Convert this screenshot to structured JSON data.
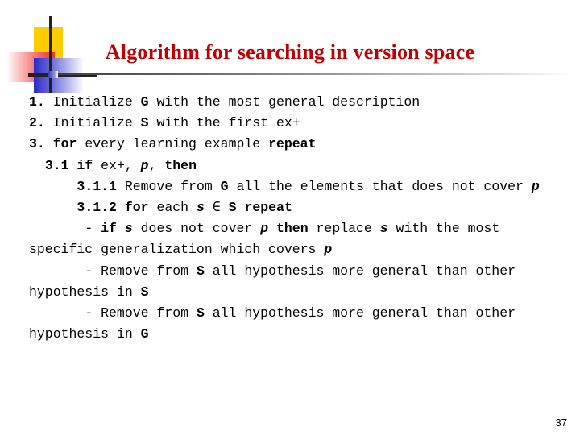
{
  "slide": {
    "title": "Algorithm for searching in version space",
    "title_color": "#C00000",
    "page_number": "37"
  },
  "decoration": {
    "yellow_swatch_color": "#FFCC00",
    "red_swatch_color": "#F03030",
    "blue_swatch_color": "#2B2BC8",
    "crossbar_color": "#222222"
  },
  "algorithm": {
    "lines": [
      {
        "id": "step-1",
        "segments": [
          {
            "text": "1. ",
            "style": "bold"
          },
          {
            "text": "Initialize ",
            "style": "normal"
          },
          {
            "text": "G",
            "style": "bold"
          },
          {
            "text": " with the most general description",
            "style": "normal"
          }
        ]
      },
      {
        "id": "step-2",
        "segments": [
          {
            "text": "2. ",
            "style": "bold"
          },
          {
            "text": "Initialize ",
            "style": "normal"
          },
          {
            "text": "S",
            "style": "bold"
          },
          {
            "text": " with the first ex+",
            "style": "normal"
          }
        ]
      },
      {
        "id": "step-3",
        "segments": [
          {
            "text": "3. ",
            "style": "bold"
          },
          {
            "text": "for",
            "style": "bold"
          },
          {
            "text": " every learning example ",
            "style": "normal"
          },
          {
            "text": "repeat",
            "style": "bold"
          }
        ]
      },
      {
        "id": "step-3-1",
        "segments": [
          {
            "text": "  3.1 ",
            "style": "bold"
          },
          {
            "text": "if",
            "style": "bold"
          },
          {
            "text": " ex+, ",
            "style": "normal"
          },
          {
            "text": "p",
            "style": "bold-italic"
          },
          {
            "text": ", ",
            "style": "normal"
          },
          {
            "text": "then",
            "style": "bold"
          }
        ]
      },
      {
        "id": "step-3-1-1",
        "segments": [
          {
            "text": "      3.1.1 ",
            "style": "bold"
          },
          {
            "text": "Remove from ",
            "style": "normal"
          },
          {
            "text": "G",
            "style": "bold"
          },
          {
            "text": " all the elements that does not cover ",
            "style": "normal"
          },
          {
            "text": "p",
            "style": "bold-italic"
          }
        ]
      },
      {
        "id": "step-3-1-2",
        "segments": [
          {
            "text": "      3.1.2 ",
            "style": "bold"
          },
          {
            "text": "for",
            "style": "bold"
          },
          {
            "text": " each ",
            "style": "normal"
          },
          {
            "text": "s",
            "style": "bold-italic"
          },
          {
            "text": " ∈ ",
            "style": "normal"
          },
          {
            "text": "S",
            "style": "bold"
          },
          {
            "text": " ",
            "style": "normal"
          },
          {
            "text": "repeat",
            "style": "bold"
          }
        ]
      },
      {
        "id": "substep-if-s",
        "segments": [
          {
            "text": "       - ",
            "style": "normal"
          },
          {
            "text": "if",
            "style": "bold"
          },
          {
            "text": " ",
            "style": "normal"
          },
          {
            "text": "s",
            "style": "bold-italic"
          },
          {
            "text": " does not cover ",
            "style": "normal"
          },
          {
            "text": "p",
            "style": "bold-italic"
          },
          {
            "text": " ",
            "style": "normal"
          },
          {
            "text": "then",
            "style": "bold"
          },
          {
            "text": " replace ",
            "style": "normal"
          },
          {
            "text": "s",
            "style": "bold-italic"
          },
          {
            "text": " with the most specific generalization which covers ",
            "style": "normal"
          },
          {
            "text": "p",
            "style": "bold-italic"
          }
        ]
      },
      {
        "id": "substep-remove-s-1",
        "segments": [
          {
            "text": "       - Remove from ",
            "style": "normal"
          },
          {
            "text": "S",
            "style": "bold"
          },
          {
            "text": " all hypothesis more general than other hypothesis in ",
            "style": "normal"
          },
          {
            "text": "S",
            "style": "bold"
          }
        ]
      },
      {
        "id": "substep-remove-s-2",
        "segments": [
          {
            "text": "       - Remove from ",
            "style": "normal"
          },
          {
            "text": "S",
            "style": "bold"
          },
          {
            "text": " all hypothesis more general than other hypothesis in ",
            "style": "normal"
          },
          {
            "text": "G",
            "style": "bold"
          }
        ]
      }
    ]
  }
}
